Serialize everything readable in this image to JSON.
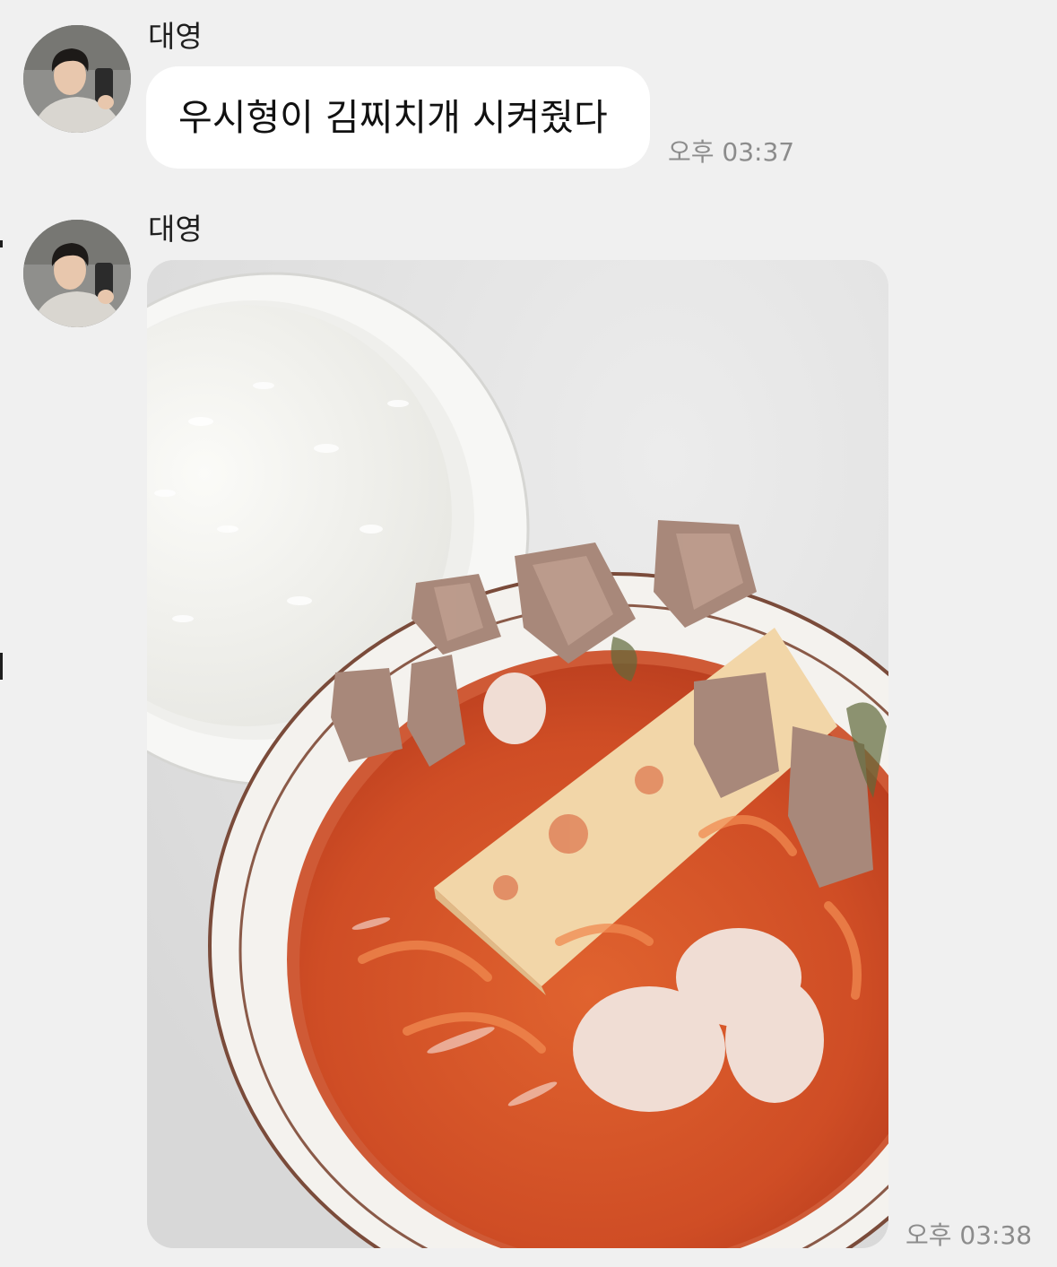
{
  "messages": [
    {
      "sender": "대영",
      "type": "text",
      "text": "우시형이 김찌치개 시켜줬다",
      "time": "오후 03:37"
    },
    {
      "sender": "대영",
      "type": "image",
      "image_subject": "kimchi-jjigae-and-rice-photo",
      "time": "오후 03:38"
    }
  ],
  "colors": {
    "background": "#f0f0f0",
    "bubble": "#ffffff",
    "timestamp": "#8c8c8c",
    "stew": "#d2542c"
  }
}
